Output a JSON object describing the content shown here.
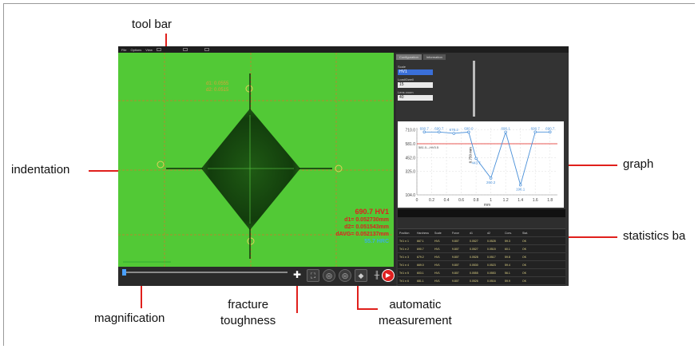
{
  "callouts": {
    "tool_bar": "tool bar",
    "indentation": "indentation",
    "graph": "graph",
    "statistics_bar": "statistics ba",
    "magnification": "magnification",
    "fracture_toughness": [
      "fracture",
      "toughness"
    ],
    "automatic_measurement": [
      "automatic",
      "measurement"
    ]
  },
  "menu": {
    "file": "File",
    "options": "Options",
    "view": "View"
  },
  "tabs": [
    "Configuration",
    "Information"
  ],
  "config": {
    "scale_label": "Scale",
    "scale_value": "HV1",
    "load_label": "Load/Dwell",
    "load_value": "15",
    "lens_label": "Lens zoom",
    "lens_value": "40"
  },
  "overlay": {
    "line1": "d1: 0.0555",
    "line2": "d2: 0.0515"
  },
  "measurement": {
    "hardness": "690.7 HV1",
    "d1": "d1= 0.052730mm",
    "d2": "d2= 0.051543mm",
    "davg": "dAVG= 0.052137mm",
    "hrc": "55.7 HRC"
  },
  "stats_head": [
    "Position",
    "Hardness",
    "Scale",
    "Force",
    "d1",
    "d2",
    "Conv.",
    "Stat."
  ],
  "stats_rows": [
    [
      "Tr/1 n 1",
      "667.1",
      "HV1",
      "9.807",
      "0.0527",
      "0.0528",
      "59.3",
      "OK"
    ],
    [
      "Tr/1 n 2",
      "690.7",
      "HV1",
      "9.807",
      "0.0527",
      "0.0515",
      "60.1",
      "OK"
    ],
    [
      "Tr/1 n 3",
      "679.2",
      "HV1",
      "9.807",
      "0.0528",
      "0.0517",
      "59.8",
      "OK"
    ],
    [
      "Tr/1 n 4",
      "669.0",
      "HV1",
      "9.807",
      "0.0530",
      "0.0523",
      "59.4",
      "OK"
    ],
    [
      "Tr/1 n 5",
      "603.1",
      "HV1",
      "9.807",
      "0.0555",
      "0.0553",
      "56.1",
      "OK"
    ],
    [
      "Tr/1 n 6",
      "681.1",
      "HV1",
      "9.807",
      "0.0526",
      "0.0516",
      "59.9",
      "OK"
    ]
  ],
  "icons": {
    "crosshair": "crosshair-icon",
    "expand": "expand-icon",
    "lens": "lens-icon",
    "indent": "diamond-indent-icon",
    "ruler": "ruler-icon",
    "play": "play-icon"
  },
  "chart_data": {
    "type": "line",
    "x": [
      0.1,
      0.3,
      0.5,
      0.7,
      0.8,
      1.0,
      1.2,
      1.4,
      1.6,
      1.8
    ],
    "values": [
      690.7,
      690.7,
      678.2,
      690.0,
      443.7,
      260.2,
      690.1,
      196.1,
      690.7,
      690.7
    ],
    "point_labels": [
      "690.7",
      "690.7",
      "678.2",
      "690.0",
      "443.7",
      "260.2",
      "690.1",
      "196.1",
      "690.7",
      "690.7"
    ],
    "reference_line": 581.0,
    "reference_label": "581.0---HV0.5",
    "yticks": [
      104.0,
      325.0,
      452.0,
      581.0,
      710.0
    ],
    "xticks": [
      0,
      0.2,
      0.4,
      0.6,
      0.8,
      1,
      1.2,
      1.4,
      1.6,
      1.8
    ],
    "xlabel": "mm",
    "ylim": [
      104,
      730
    ],
    "xlim": [
      0,
      1.9
    ],
    "vertical_label": "0.750 mm",
    "colors": {
      "line": "#4a90d9",
      "reference": "#e0201c"
    }
  }
}
